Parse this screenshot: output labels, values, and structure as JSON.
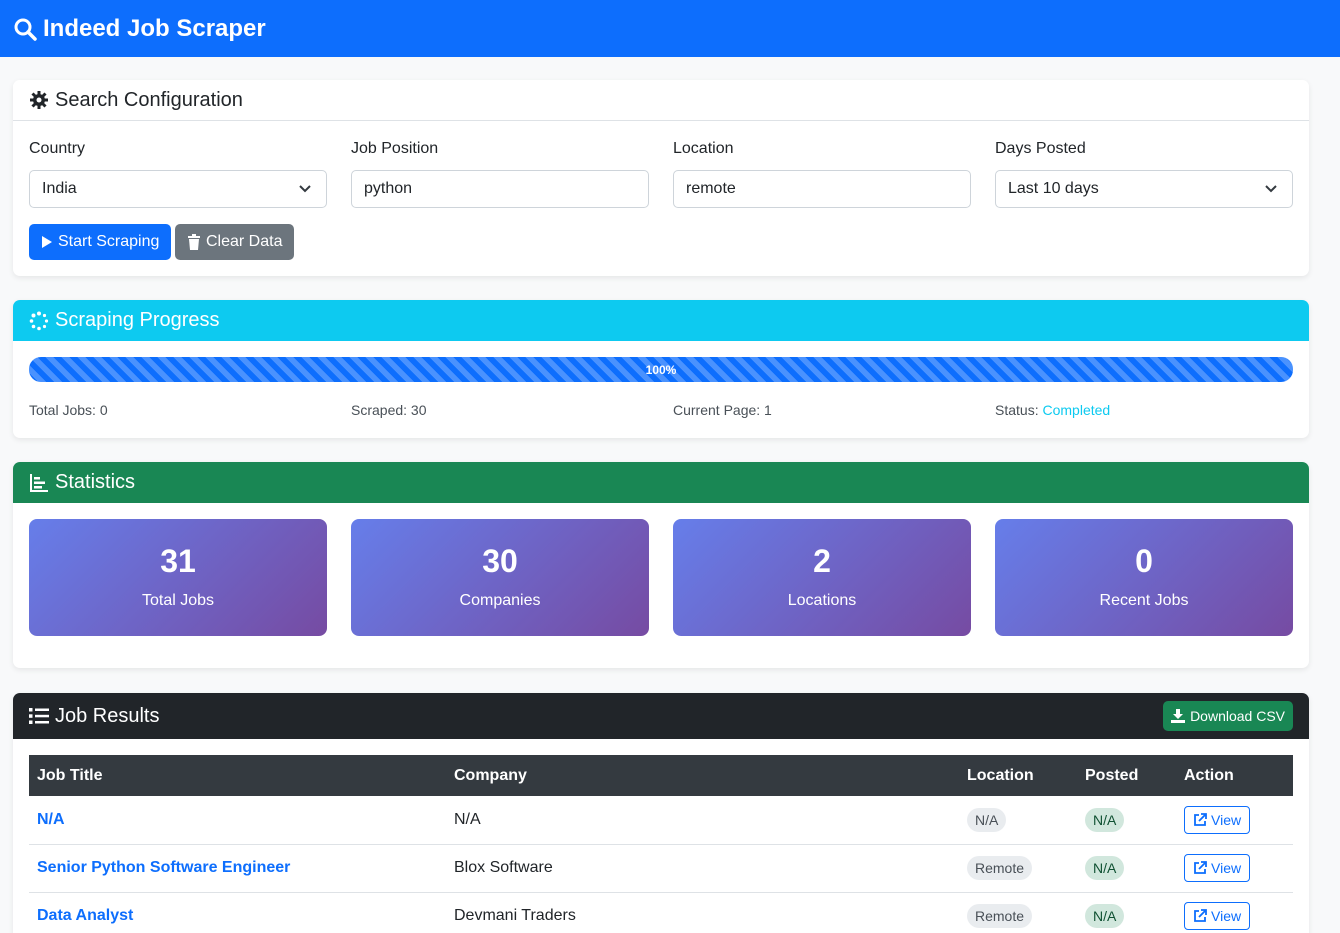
{
  "app": {
    "title": "Indeed Job Scraper"
  },
  "search": {
    "header": "Search Configuration",
    "country_label": "Country",
    "country_value": "India",
    "position_label": "Job Position",
    "position_value": "python",
    "location_label": "Location",
    "location_value": "remote",
    "days_label": "Days Posted",
    "days_value": "Last 10 days",
    "start_label": "Start Scraping",
    "clear_label": "Clear Data"
  },
  "progress": {
    "header": "Scraping Progress",
    "percent": 100,
    "percent_label": "100%",
    "total_jobs": "Total Jobs: 0",
    "scraped": "Scraped: 30",
    "current_page": "Current Page: 1",
    "status_prefix": "Status:",
    "status_value": "Completed"
  },
  "stats": {
    "header": "Statistics",
    "items": [
      {
        "value": "31",
        "label": "Total Jobs"
      },
      {
        "value": "30",
        "label": "Companies"
      },
      {
        "value": "2",
        "label": "Locations"
      },
      {
        "value": "0",
        "label": "Recent Jobs"
      }
    ]
  },
  "results": {
    "header": "Job Results",
    "download_label": "Download CSV",
    "columns": [
      "Job Title",
      "Company",
      "Location",
      "Posted",
      "Action"
    ],
    "rows": [
      {
        "title": "N/A",
        "company": "N/A",
        "location": "N/A",
        "posted": "N/A",
        "action": "View"
      },
      {
        "title": "Senior Python Software Engineer",
        "company": "Blox Software",
        "location": "Remote",
        "posted": "N/A",
        "action": "View"
      },
      {
        "title": "Data Analyst",
        "company": "Devmani Traders",
        "location": "Remote",
        "posted": "N/A",
        "action": "View"
      }
    ]
  },
  "colors": {
    "primary": "#0d6efd",
    "info": "#0dcaf0",
    "success": "#198754",
    "dark": "#212529",
    "stat_from": "#667eea",
    "stat_to": "#764ba2"
  }
}
